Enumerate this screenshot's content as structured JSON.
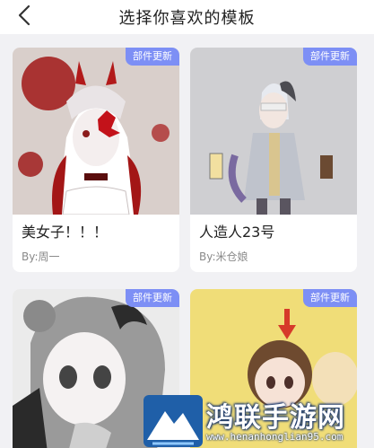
{
  "header": {
    "title": "选择你喜欢的模板"
  },
  "templates": [
    {
      "title": "美女子！！！",
      "author": "By:周一",
      "badge": "部件更新"
    },
    {
      "title": "人造人23号",
      "author": "By:米仓娘",
      "badge": "部件更新"
    },
    {
      "title": "",
      "author": "",
      "badge": "部件更新"
    },
    {
      "title": "",
      "author": "",
      "badge": "部件更新"
    }
  ],
  "watermark": {
    "text": "鸿联手游网",
    "url": "www.henanhonglian95.com"
  },
  "icons": {
    "back": "chevron-left-icon",
    "logo": "mountain-logo-icon"
  },
  "colors": {
    "badge": "#7d8ff5",
    "background": "#f1f1f4",
    "card": "#ffffff"
  }
}
